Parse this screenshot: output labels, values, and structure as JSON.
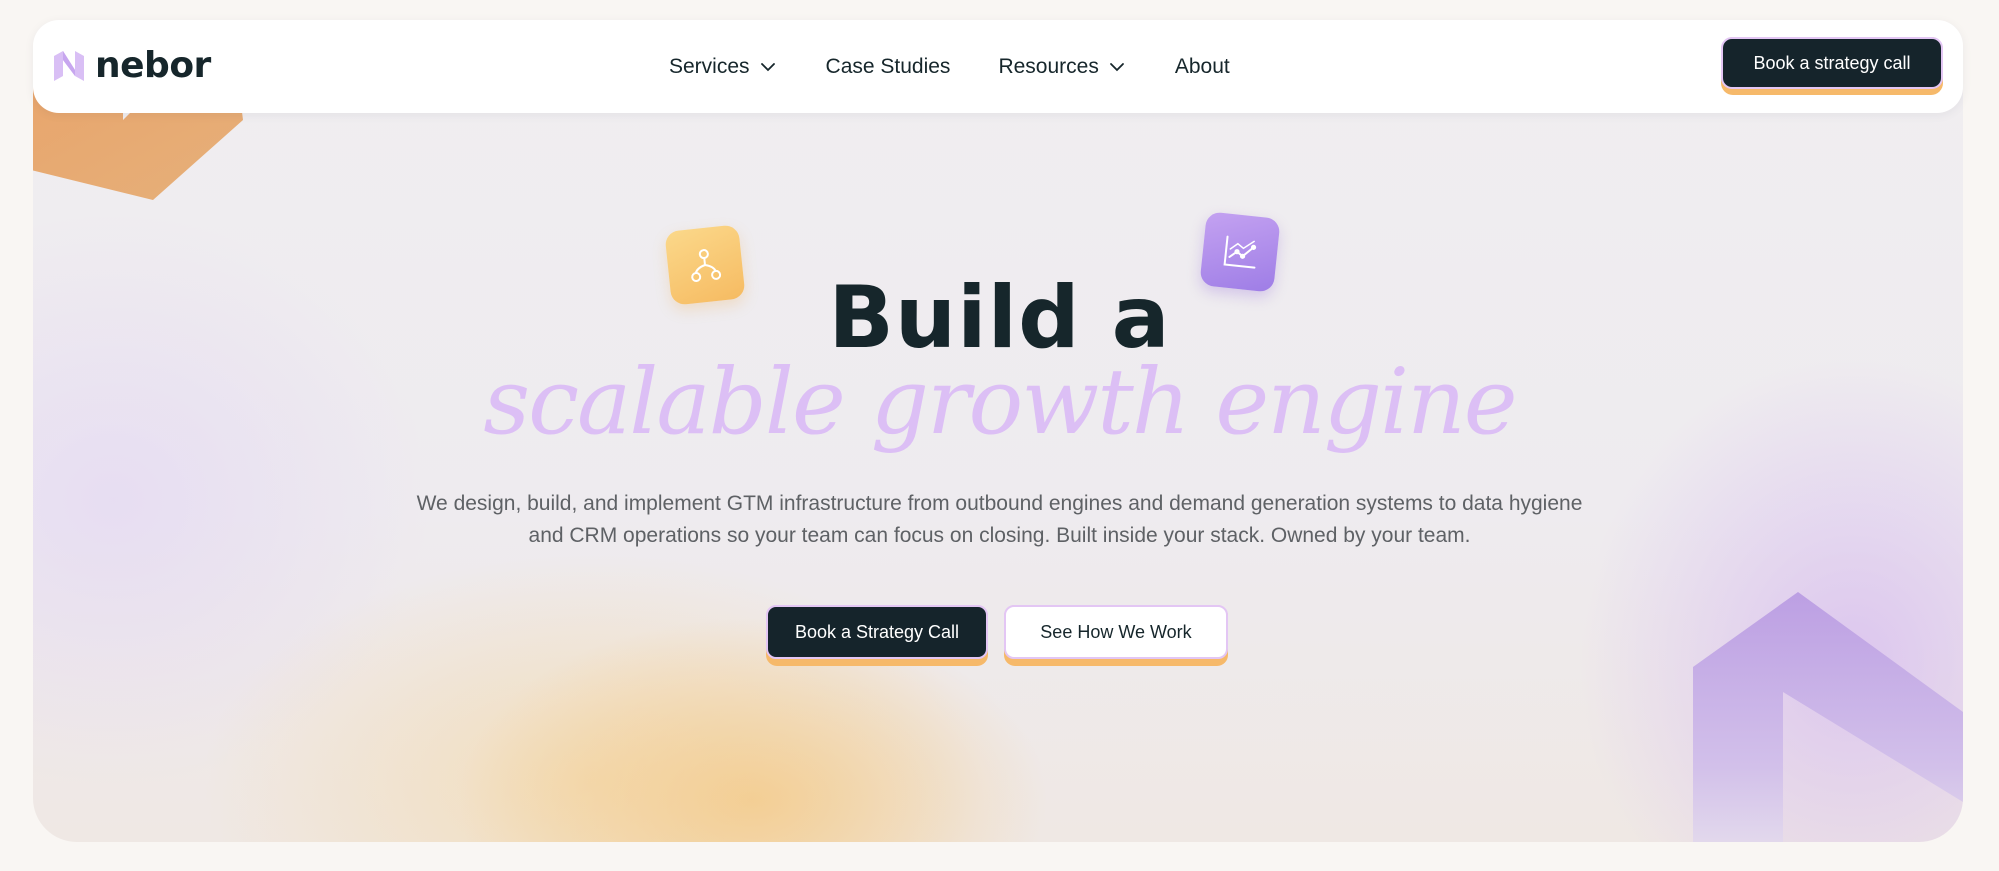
{
  "brand": {
    "name": "nebor"
  },
  "nav": {
    "items": [
      {
        "label": "Services",
        "has_dropdown": true
      },
      {
        "label": "Case Studies",
        "has_dropdown": false
      },
      {
        "label": "Resources",
        "has_dropdown": true
      },
      {
        "label": "About",
        "has_dropdown": false
      }
    ],
    "cta_label": "Book a strategy call"
  },
  "hero": {
    "headline": "Build a",
    "headline_accent": "scalable growth engine",
    "description": "We design, build, and implement GTM infrastructure from outbound engines and demand generation systems to data hygiene and CRM operations so your team can focus on closing. Built inside your stack. Owned by your team.",
    "primary_cta": "Book a Strategy Call",
    "secondary_cta": "See How We Work"
  },
  "icons": {
    "orange_tile": "workflow-branch-icon",
    "purple_tile": "line-chart-icon",
    "dropdown": "chevron-down-icon"
  },
  "colors": {
    "dark": "#15242b",
    "accent_purple": "#dcbff5",
    "accent_orange": "#f6b96a",
    "background": "#f9f6f3"
  }
}
